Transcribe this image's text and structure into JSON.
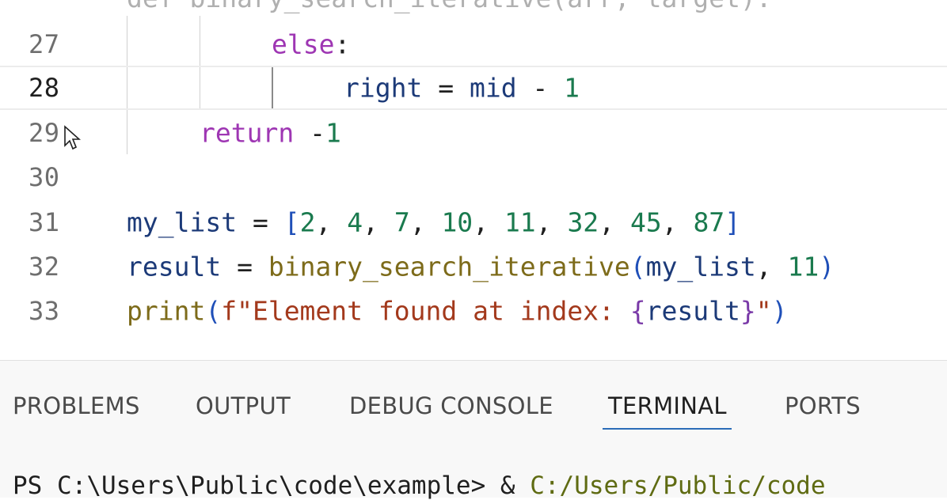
{
  "editor": {
    "top_fragment": "def binary_search_iterative(arr, target):",
    "lines": [
      {
        "number": "27",
        "tokens": [
          {
            "t": "else",
            "c": "kw"
          },
          {
            "t": ":",
            "c": "op"
          }
        ]
      },
      {
        "number": "28",
        "tokens": [
          {
            "t": "right",
            "c": "var"
          },
          {
            "t": " = ",
            "c": "op"
          },
          {
            "t": "mid",
            "c": "var"
          },
          {
            "t": " - ",
            "c": "op"
          },
          {
            "t": "1",
            "c": "num"
          }
        ]
      },
      {
        "number": "29",
        "tokens": [
          {
            "t": "return",
            "c": "kw"
          },
          {
            "t": " -",
            "c": "op"
          },
          {
            "t": "1",
            "c": "num"
          }
        ]
      },
      {
        "number": "30",
        "tokens": []
      },
      {
        "number": "31",
        "tokens": [
          {
            "t": "my_list",
            "c": "var"
          },
          {
            "t": " = ",
            "c": "op"
          },
          {
            "t": "[",
            "c": "br"
          },
          {
            "t": "2",
            "c": "num"
          },
          {
            "t": ", ",
            "c": "op"
          },
          {
            "t": "4",
            "c": "num"
          },
          {
            "t": ", ",
            "c": "op"
          },
          {
            "t": "7",
            "c": "num"
          },
          {
            "t": ", ",
            "c": "op"
          },
          {
            "t": "10",
            "c": "num"
          },
          {
            "t": ", ",
            "c": "op"
          },
          {
            "t": "11",
            "c": "num"
          },
          {
            "t": ", ",
            "c": "op"
          },
          {
            "t": "32",
            "c": "num"
          },
          {
            "t": ", ",
            "c": "op"
          },
          {
            "t": "45",
            "c": "num"
          },
          {
            "t": ", ",
            "c": "op"
          },
          {
            "t": "87",
            "c": "num"
          },
          {
            "t": "]",
            "c": "br"
          }
        ]
      },
      {
        "number": "32",
        "tokens": [
          {
            "t": "result",
            "c": "var"
          },
          {
            "t": " = ",
            "c": "op"
          },
          {
            "t": "binary_search_iterative",
            "c": "fn"
          },
          {
            "t": "(",
            "c": "br"
          },
          {
            "t": "my_list",
            "c": "var"
          },
          {
            "t": ", ",
            "c": "op"
          },
          {
            "t": "11",
            "c": "num"
          },
          {
            "t": ")",
            "c": "br"
          }
        ]
      },
      {
        "number": "33",
        "tokens": [
          {
            "t": "print",
            "c": "fn"
          },
          {
            "t": "(",
            "c": "br"
          },
          {
            "t": "f\"Element found at index: ",
            "c": "str"
          },
          {
            "t": "{",
            "c": "br2"
          },
          {
            "t": "result",
            "c": "var"
          },
          {
            "t": "}",
            "c": "br2"
          },
          {
            "t": "\"",
            "c": "str"
          },
          {
            "t": ")",
            "c": "br"
          }
        ]
      }
    ]
  },
  "panel": {
    "tabs": [
      "PROBLEMS",
      "OUTPUT",
      "DEBUG CONSOLE",
      "TERMINAL",
      "PORTS"
    ],
    "active_tab": "TERMINAL",
    "terminal": {
      "prompt": "PS C:\\Users\\Public\\code\\example> & ",
      "command": "C:/Users/Public/code"
    }
  },
  "colors": {
    "keyword": "#9e36b3",
    "variable": "#1c3a78",
    "number": "#1a7a4e",
    "function": "#7d6b1a",
    "string": "#a3391c",
    "accent": "#2b6cb8"
  }
}
